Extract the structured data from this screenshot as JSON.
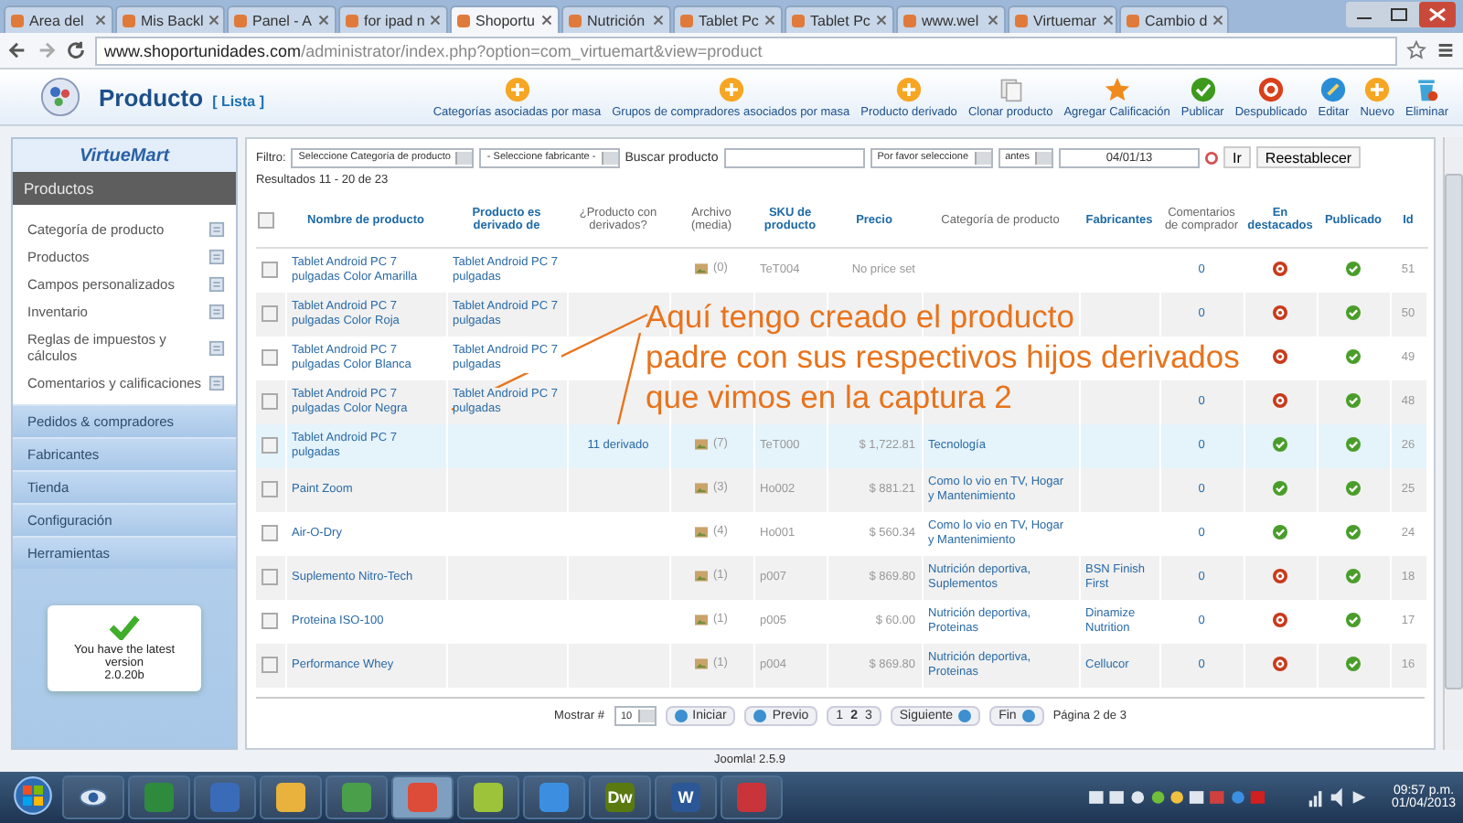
{
  "browser": {
    "tabs": [
      {
        "title": "Area del",
        "selected": false
      },
      {
        "title": "Mis Backl",
        "selected": false
      },
      {
        "title": "Panel - A",
        "selected": false
      },
      {
        "title": "for ipad n",
        "selected": false
      },
      {
        "title": "Shoportu",
        "selected": true
      },
      {
        "title": "Nutrición",
        "selected": false
      },
      {
        "title": "Tablet Pc",
        "selected": false
      },
      {
        "title": "Tablet Pc",
        "selected": false
      },
      {
        "title": "www.wel",
        "selected": false
      },
      {
        "title": "Virtuemar",
        "selected": false
      },
      {
        "title": "Cambio d",
        "selected": false
      }
    ],
    "url": {
      "host": "www.shoportunidades.com",
      "path": "/administrator/index.php?option=com_virtuemart&view=product"
    }
  },
  "header": {
    "title": "Producto",
    "subtitle": "[ Lista ]"
  },
  "toolbar": [
    {
      "label": "Categorías asociadas por masa",
      "kind": "add"
    },
    {
      "label": "Grupos de compradores asociados por masa",
      "kind": "add"
    },
    {
      "label": "Producto derivado",
      "kind": "add"
    },
    {
      "label": "Clonar producto",
      "kind": "copy"
    },
    {
      "label": "Agregar Calificación",
      "kind": "star"
    },
    {
      "label": "Publicar",
      "kind": "publish"
    },
    {
      "label": "Despublicado",
      "kind": "unpublish"
    },
    {
      "label": "Editar",
      "kind": "edit"
    },
    {
      "label": "Nuevo",
      "kind": "add"
    },
    {
      "label": "Eliminar",
      "kind": "delete"
    }
  ],
  "sidebar": {
    "logo": "VirtueMart",
    "section": "Productos",
    "items": [
      "Categoría de producto",
      "Productos",
      "Campos personalizados",
      "Inventario",
      "Reglas de impuestos y cálculos",
      "Comentarios y calificaciones"
    ],
    "groups": [
      "Pedidos & compradores",
      "Fabricantes",
      "Tienda",
      "Configuración",
      "Herramientas"
    ],
    "version_box": {
      "text": "You have the latest version",
      "version": "2.0.20b"
    }
  },
  "filter": {
    "label": "Filtro:",
    "category": "Seleccione Categoría de producto",
    "manufacturer": "- Seleccione fabricante -",
    "search_label": "Buscar producto",
    "date_type": "Por favor seleccione",
    "date_mode": "antes",
    "date": "04/01/13",
    "go": "Ir",
    "reset": "Reestablecer"
  },
  "results": "Resultados 11 - 20 de 23",
  "table": {
    "select_all_checked": false,
    "columns": [
      {
        "label": "Nombre de producto",
        "link": true
      },
      {
        "label": "Producto es derivado de",
        "link": true
      },
      {
        "label": "¿Producto con derivados?",
        "link": false
      },
      {
        "label": "Archivo (media)",
        "link": false
      },
      {
        "label": "SKU de producto",
        "link": true
      },
      {
        "label": "Precio",
        "link": true
      },
      {
        "label": "Categoría de producto",
        "link": false
      },
      {
        "label": "Fabricantes",
        "link": true
      },
      {
        "label": "Comentarios de comprador",
        "link": false
      },
      {
        "label": "En destacados",
        "link": true
      },
      {
        "label": "Publicado",
        "link": true
      },
      {
        "label": "Id",
        "link": true
      }
    ],
    "rows": [
      {
        "checked": false,
        "name": "Tablet Android PC 7 pulgadas Color Amarilla",
        "parent": "Tablet Android PC 7 pulgadas",
        "children": "",
        "media": "(0)",
        "sku": "TeT004",
        "price": "No price set",
        "category": "",
        "manufacturer": "",
        "reviews": "0",
        "featured": false,
        "published": true,
        "id": "51",
        "highlighted": false
      },
      {
        "checked": false,
        "name": "Tablet Android PC 7 pulgadas Color Roja",
        "parent": "Tablet Android PC 7 pulgadas",
        "children": "",
        "media": "",
        "sku": "",
        "price": "",
        "category": "",
        "manufacturer": "",
        "reviews": "0",
        "featured": false,
        "published": true,
        "id": "50",
        "highlighted": false
      },
      {
        "checked": false,
        "name": "Tablet Android PC 7 pulgadas Color Blanca",
        "parent": "Tablet Android PC 7 pulgadas",
        "children": "",
        "media": "",
        "sku": "",
        "price": "",
        "category": "",
        "manufacturer": "",
        "reviews": "",
        "featured": false,
        "published": true,
        "id": "49",
        "highlighted": false
      },
      {
        "checked": false,
        "name": "Tablet Android PC 7 pulgadas Color Negra",
        "parent": "Tablet Android PC 7 pulgadas",
        "children": "",
        "media": "",
        "sku": "",
        "price": "",
        "category": "",
        "manufacturer": "",
        "reviews": "0",
        "featured": false,
        "published": true,
        "id": "48",
        "highlighted": false
      },
      {
        "checked": false,
        "name": "Tablet Android PC 7 pulgadas",
        "parent": "",
        "children": "11 derivado",
        "media": "(7)",
        "sku": "TeT000",
        "price": "$ 1,722.81",
        "category": "Tecnología",
        "manufacturer": "",
        "reviews": "0",
        "featured": true,
        "published": true,
        "id": "26",
        "highlighted": true
      },
      {
        "checked": false,
        "name": "Paint Zoom",
        "parent": "",
        "children": "",
        "media": "(3)",
        "sku": "Ho002",
        "price": "$ 881.21",
        "category": "Como lo vio en TV, Hogar y Mantenimiento",
        "manufacturer": "",
        "reviews": "0",
        "featured": true,
        "published": true,
        "id": "25",
        "highlighted": false
      },
      {
        "checked": false,
        "name": "Air-O-Dry",
        "parent": "",
        "children": "",
        "media": "(4)",
        "sku": "Ho001",
        "price": "$ 560.34",
        "category": "Como lo vio en TV, Hogar y Mantenimiento",
        "manufacturer": "",
        "reviews": "0",
        "featured": true,
        "published": true,
        "id": "24",
        "highlighted": false
      },
      {
        "checked": false,
        "name": "Suplemento Nitro-Tech",
        "parent": "",
        "children": "",
        "media": "(1)",
        "sku": "p007",
        "price": "$ 869.80",
        "category": "Nutrición deportiva, Suplementos",
        "manufacturer": "BSN Finish First",
        "reviews": "0",
        "featured": false,
        "published": true,
        "id": "18",
        "highlighted": false
      },
      {
        "checked": false,
        "name": "Proteina ISO-100",
        "parent": "",
        "children": "",
        "media": "(1)",
        "sku": "p005",
        "price": "$ 60.00",
        "category": "Nutrición deportiva, Proteinas",
        "manufacturer": "Dinamize Nutrition",
        "reviews": "0",
        "featured": false,
        "published": true,
        "id": "17",
        "highlighted": false
      },
      {
        "checked": false,
        "name": "Performance Whey",
        "parent": "",
        "children": "",
        "media": "(1)",
        "sku": "p004",
        "price": "$ 869.80",
        "category": "Nutrición deportiva, Proteinas",
        "manufacturer": "Cellucor",
        "reviews": "0",
        "featured": false,
        "published": true,
        "id": "16",
        "highlighted": false
      }
    ]
  },
  "pagination": {
    "show_label": "Mostrar #",
    "per_page": "10",
    "first": "Iniciar",
    "prev": "Previo",
    "pages": [
      {
        "label": "1",
        "selected": false
      },
      {
        "label": "2",
        "selected": true
      },
      {
        "label": "3",
        "selected": false
      }
    ],
    "next": "Siguiente",
    "last": "Fin",
    "info": "Página 2 de 3"
  },
  "annotation": [
    "Aquí tengo creado el producto",
    "padre con sus respectivos hijos derivados",
    "que vimos en la captura 2"
  ],
  "footer": "Joomla! 2.5.9",
  "taskbar": {
    "apps": [
      {
        "kind": "excel",
        "active": false
      },
      {
        "kind": "network",
        "active": false
      },
      {
        "kind": "mail",
        "active": false
      },
      {
        "kind": "people",
        "active": false
      },
      {
        "kind": "browser",
        "active": true
      },
      {
        "kind": "leaf",
        "active": false
      },
      {
        "kind": "globe",
        "active": false
      },
      {
        "kind": "dw",
        "label": "Dw",
        "active": false
      },
      {
        "kind": "word",
        "label": "W",
        "active": false
      },
      {
        "kind": "camera",
        "active": false
      }
    ],
    "time": "09:57 p.m.",
    "date": "01/04/2013"
  }
}
